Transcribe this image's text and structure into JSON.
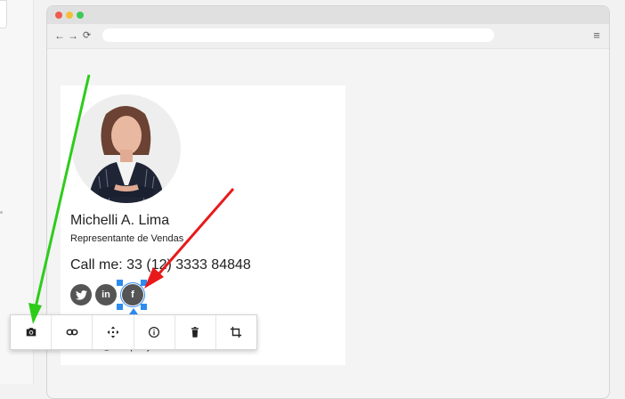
{
  "signature": {
    "name": "Michelli A. Lima",
    "title": "Representante de Vendas",
    "phone": "Call me: 33 (12) 3333 84848",
    "email": "contact@company.com"
  },
  "social_icons": [
    {
      "name": "twitter-icon",
      "glyph": "♥"
    },
    {
      "name": "linkedin-icon",
      "glyph": "in"
    },
    {
      "name": "facebook-icon",
      "glyph": "f"
    }
  ],
  "toolbar": {
    "buttons": [
      "camera-icon",
      "link-icon",
      "move-icon",
      "info-icon",
      "trash-icon",
      "crop-icon"
    ]
  },
  "colors": {
    "selection": "#2d8cf0",
    "annotation_green": "#2ecc1a",
    "annotation_red": "#e8191a"
  }
}
